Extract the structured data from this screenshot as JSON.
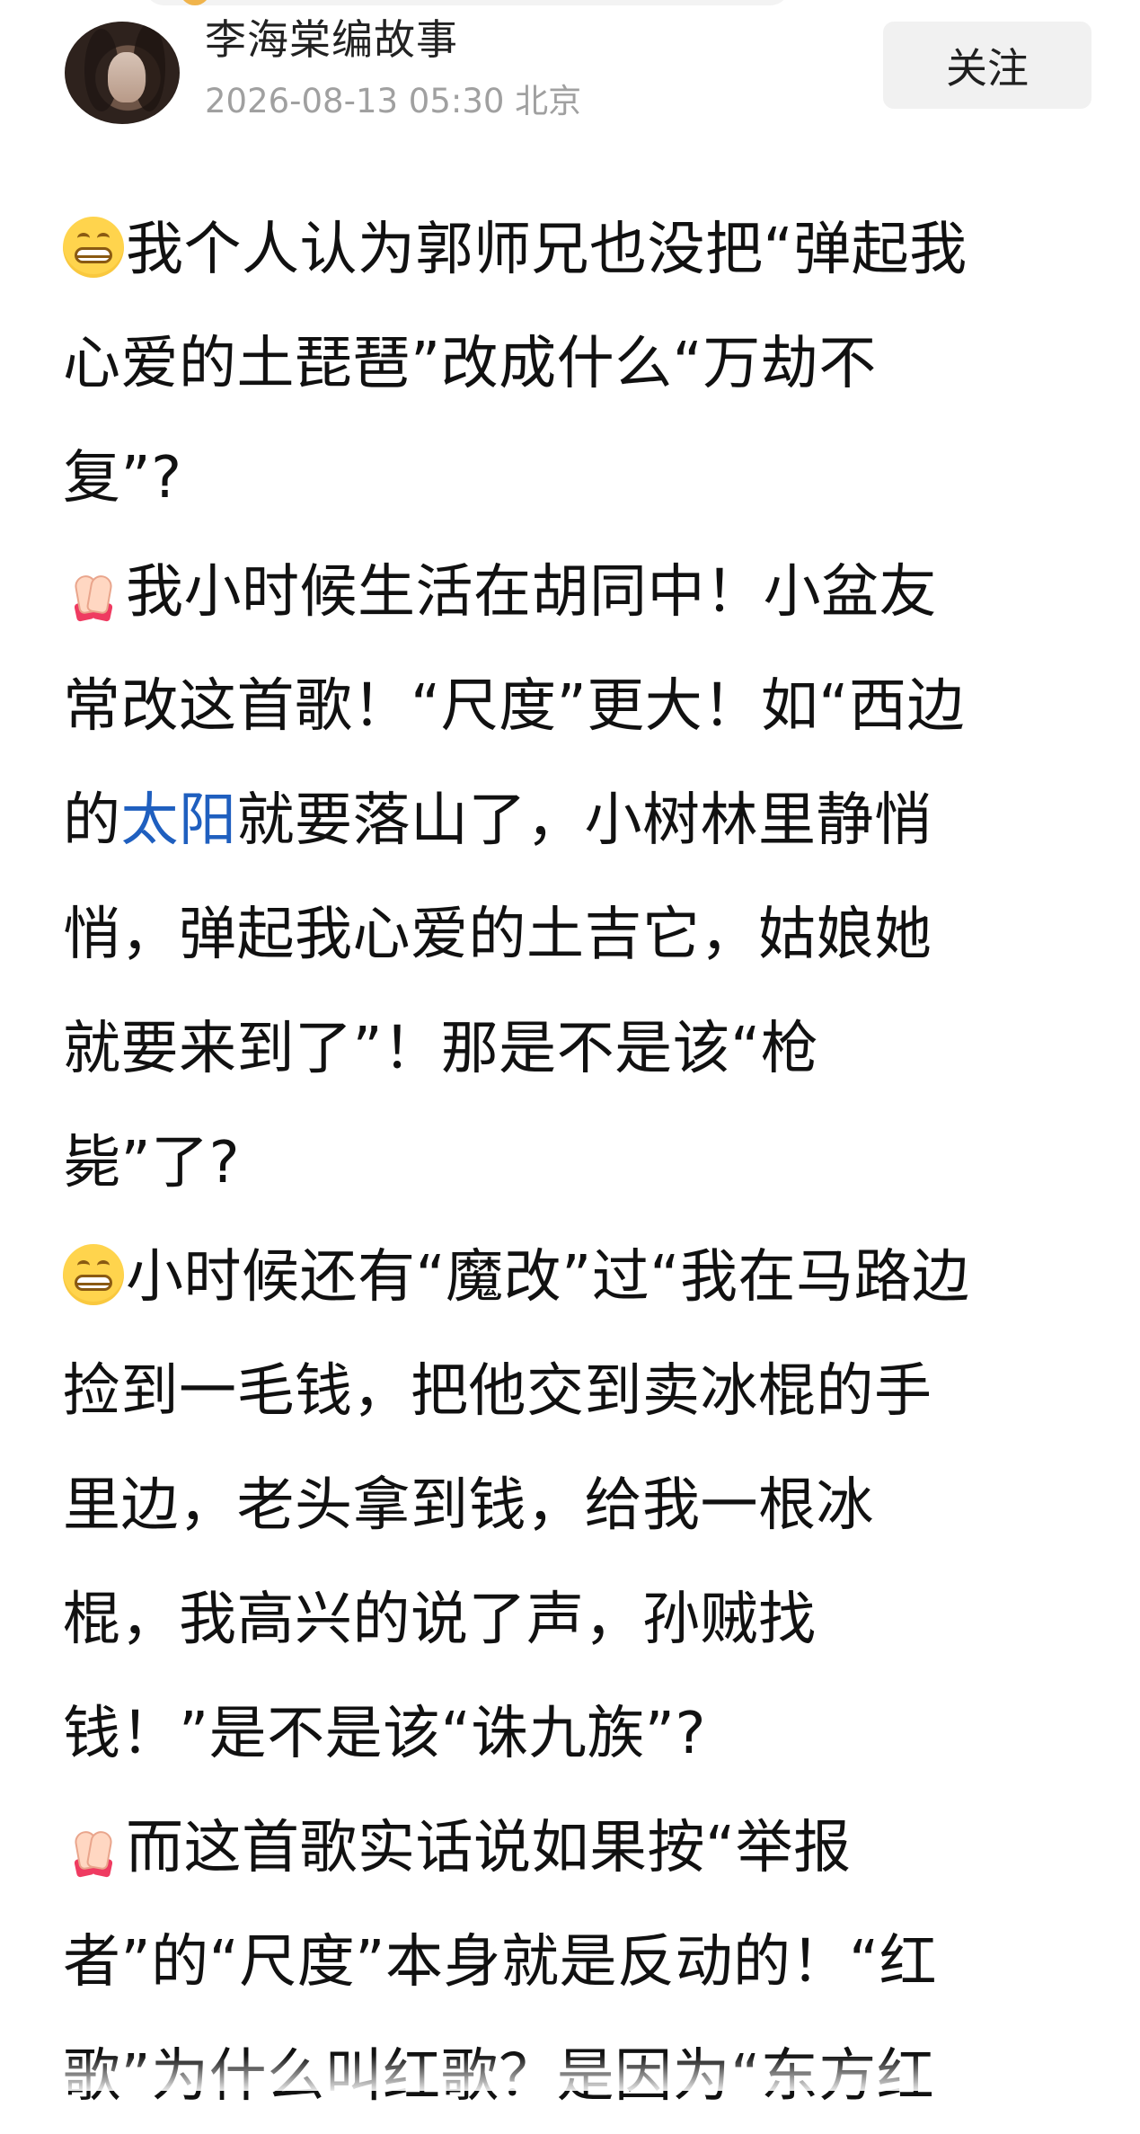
{
  "header": {
    "author_name": "李海棠编故事",
    "post_time": "2026-08-13 05:30 北京",
    "follow_label": "关注"
  },
  "post": {
    "lines": [
      {
        "emoji": "grinning-face-icon",
        "text": "我个人认为郭师兄也没把“弹起我"
      },
      {
        "text": "心爱的土琵琶”改成什么“万劫不"
      },
      {
        "text": "复”?"
      },
      {
        "emoji": "folded-hands-icon",
        "text": "我小时候生活在胡同中！小盆友"
      },
      {
        "text": "常改这首歌！“尺度”更大！如“西边"
      },
      {
        "prefix": "的",
        "link": "太阳",
        "suffix": "就要落山了，小树林里静悄"
      },
      {
        "text": "悄，弹起我心爱的土吉它，姑娘她"
      },
      {
        "text": "就要来到了”！那是不是该“枪"
      },
      {
        "text": "毙”了?"
      },
      {
        "emoji": "grinning-face-icon",
        "text": "小时候还有“魔改”过“我在马路边"
      },
      {
        "text": "捡到一毛钱，把他交到卖冰棍的手"
      },
      {
        "text": "里边，老头拿到钱，给我一根冰"
      },
      {
        "text": "棍，我高兴的说了声，孙贼找"
      },
      {
        "text": "钱！”是不是该“诛九族”?"
      },
      {
        "emoji": "folded-hands-icon",
        "text": "而这首歌实话说如果按“举报"
      },
      {
        "text": "者”的“尺度”本身就是反动的！“红"
      },
      {
        "text": "歌”为什么叫红歌？是因为“东方红"
      }
    ]
  },
  "colors": {
    "link": "#1f5fbf",
    "timestamp": "#a0a0a0",
    "button_bg": "#f1f1f1",
    "text": "#111111"
  }
}
